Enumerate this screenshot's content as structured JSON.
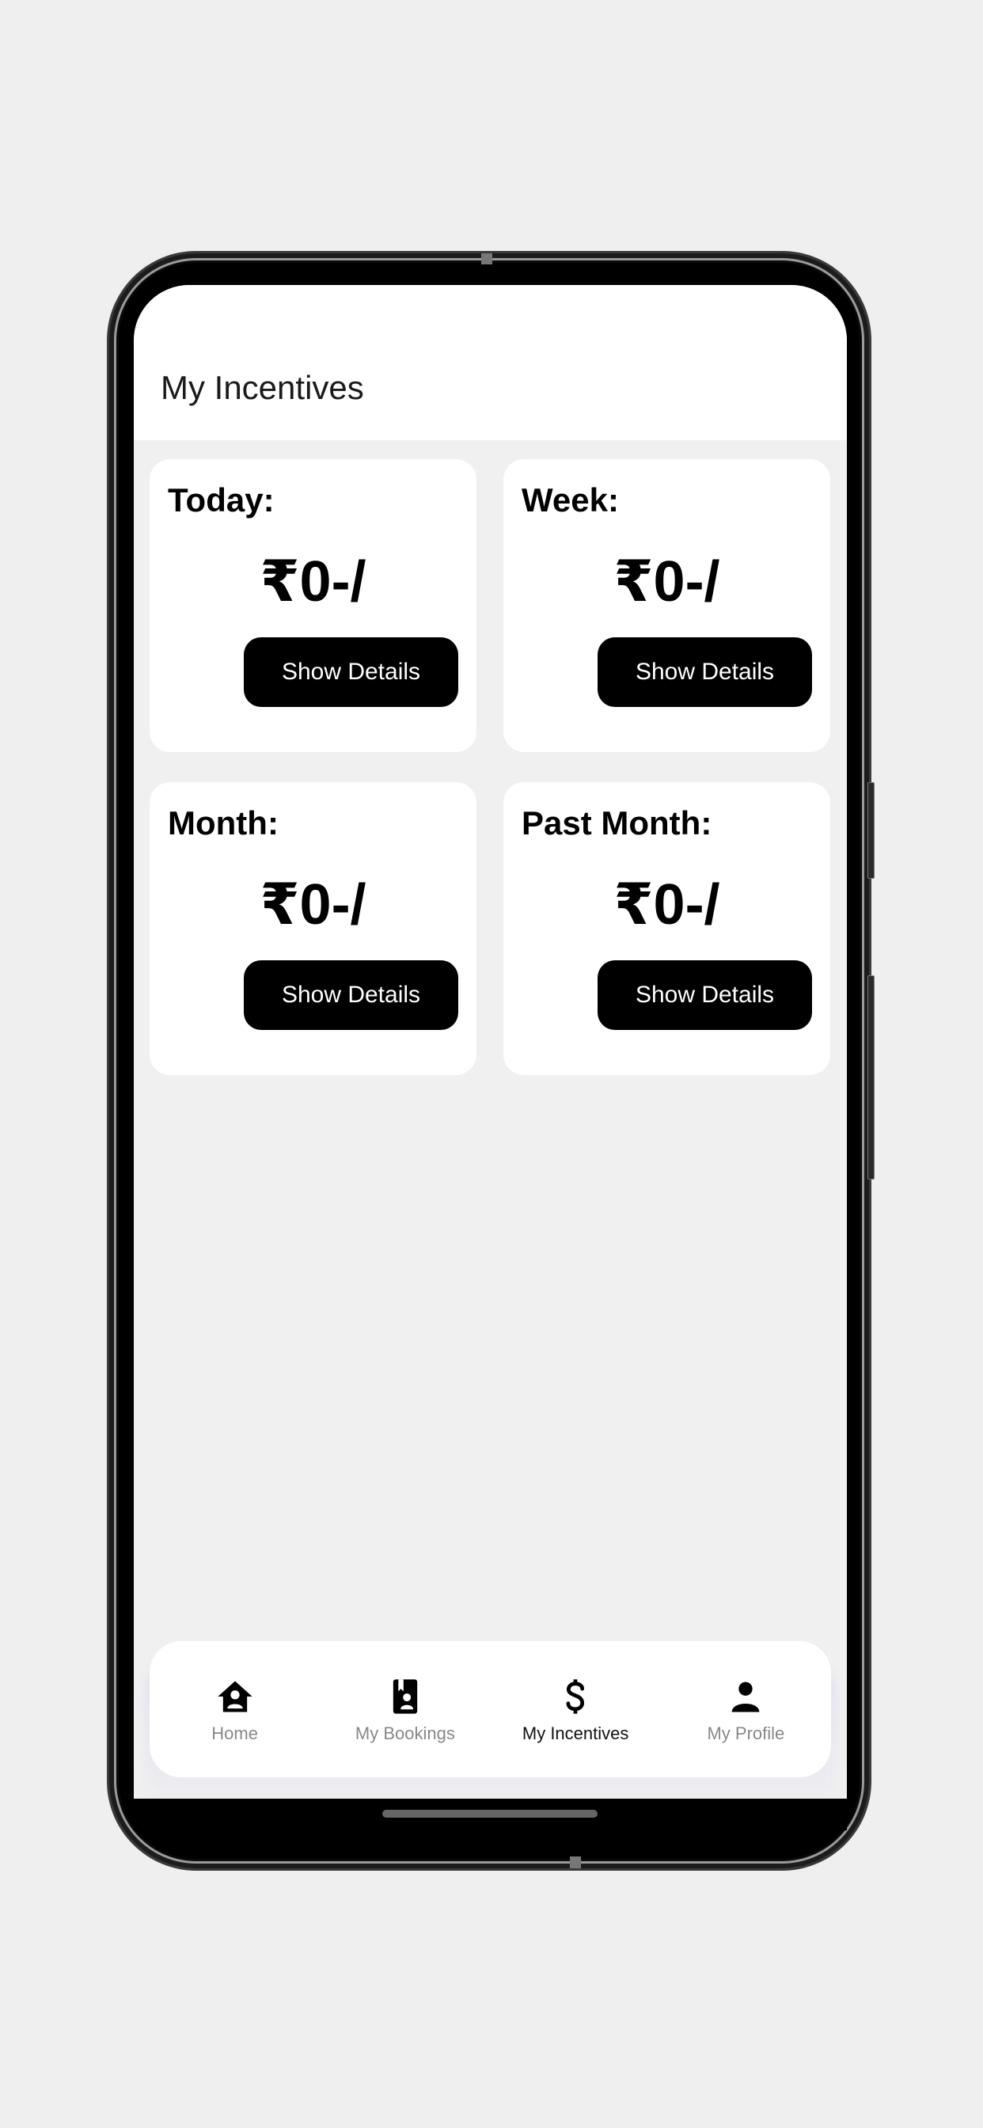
{
  "header": {
    "title": "My Incentives"
  },
  "currency_symbol": "₹",
  "cards": [
    {
      "label": "Today:",
      "amount": "₹0-/",
      "button": "Show Details"
    },
    {
      "label": "Week:",
      "amount": "₹0-/",
      "button": "Show Details"
    },
    {
      "label": "Month:",
      "amount": "₹0-/",
      "button": "Show Details"
    },
    {
      "label": "Past Month:",
      "amount": "₹0-/",
      "button": "Show Details"
    }
  ],
  "bottom_nav": {
    "active_index": 2,
    "items": [
      {
        "label": "Home",
        "icon": "home-person-icon"
      },
      {
        "label": "My Bookings",
        "icon": "contact-book-icon"
      },
      {
        "label": "My Incentives",
        "icon": "dollar-icon"
      },
      {
        "label": "My Profile",
        "icon": "person-icon"
      }
    ]
  },
  "colors": {
    "background": "#efefef",
    "surface": "#ffffff",
    "button_bg": "#000000",
    "button_text": "#ffffff",
    "nav_inactive": "#888888",
    "nav_active": "#111111"
  }
}
